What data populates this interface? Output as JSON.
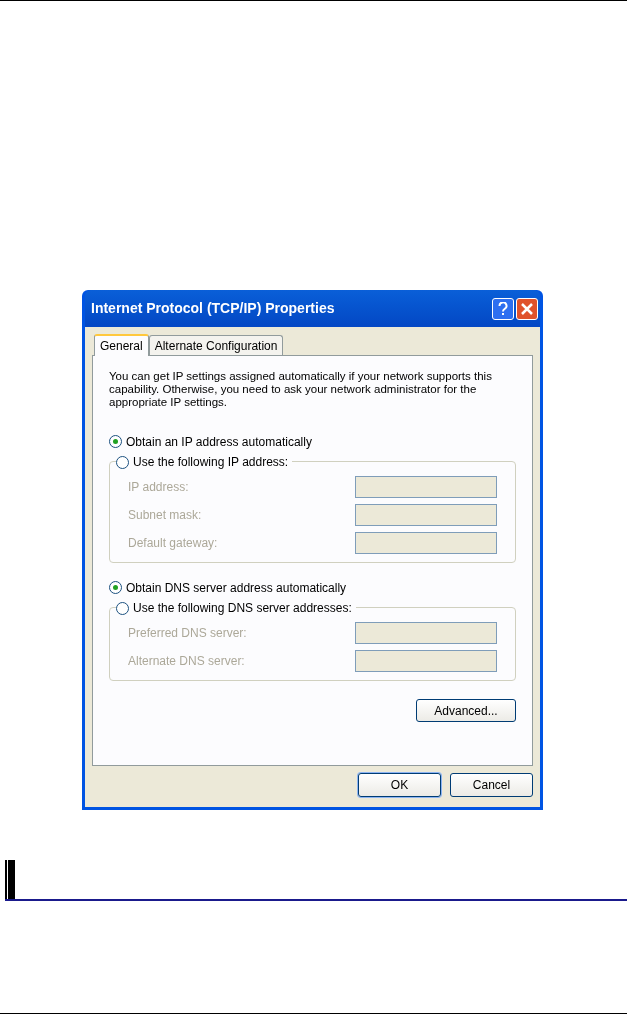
{
  "dialog": {
    "title": "Internet Protocol (TCP/IP) Properties",
    "tabs": [
      {
        "label": "General",
        "selected": true
      },
      {
        "label": "Alternate Configuration",
        "selected": false
      }
    ],
    "intro": "You can get IP settings assigned automatically if your network supports this capability. Otherwise, you need to ask your network administrator for the appropriate IP settings.",
    "sections": [
      {
        "auto": {
          "label": "Obtain an IP address automatically",
          "selected": true
        },
        "manual": {
          "label": "Use the following IP address:",
          "selected": false
        },
        "fields": [
          {
            "label": "IP address:",
            "disabled": true
          },
          {
            "label": "Subnet mask:",
            "disabled": true
          },
          {
            "label": "Default gateway:",
            "disabled": true
          }
        ]
      },
      {
        "auto": {
          "label": "Obtain DNS server address automatically",
          "selected": true
        },
        "manual": {
          "label": "Use the following DNS server addresses:",
          "selected": false
        },
        "fields": [
          {
            "label": "Preferred DNS server:",
            "disabled": true
          },
          {
            "label": "Alternate DNS server:",
            "disabled": true
          }
        ]
      }
    ],
    "advanced_button": "Advanced...",
    "buttons": [
      "OK",
      "Cancel"
    ]
  }
}
